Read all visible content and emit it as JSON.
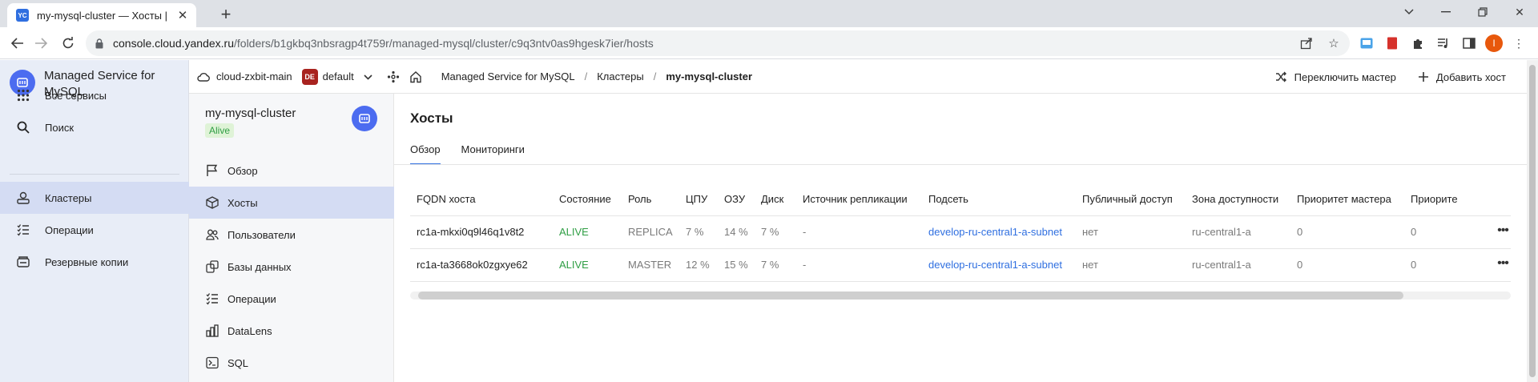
{
  "browser": {
    "tab_title": "my-mysql-cluster — Хосты | Кл",
    "tab_favicon_text": "YC",
    "url_host": "console.cloud.yandex.ru",
    "url_path": "/folders/b1gkbq3nbsragp4t759r/managed-mysql/cluster/c9q3ntv0as9hgesk7ier/hosts",
    "profile_initial": "I"
  },
  "service": {
    "name": "Managed Service for MySQL",
    "nav": [
      {
        "label": "Все сервисы",
        "icon": "grid-icon"
      },
      {
        "label": "Поиск",
        "icon": "search-icon"
      },
      {
        "label": "Кластеры",
        "icon": "clusters-icon",
        "active": true
      },
      {
        "label": "Операции",
        "icon": "operations-icon"
      },
      {
        "label": "Резервные копии",
        "icon": "backup-icon"
      }
    ]
  },
  "topbar": {
    "cloud": "cloud-zxbit-main",
    "folder_badge": "DE",
    "folder": "default",
    "breadcrumbs": [
      "Managed Service for MySQL",
      "Кластеры",
      "my-mysql-cluster"
    ],
    "actions": {
      "switch_master": "Переключить мастер",
      "add_host": "Добавить хост"
    }
  },
  "cluster": {
    "name": "my-mysql-cluster",
    "status": "Alive",
    "nav": [
      {
        "label": "Обзор",
        "icon": "flag-icon"
      },
      {
        "label": "Хосты",
        "icon": "cube-icon",
        "active": true
      },
      {
        "label": "Пользователи",
        "icon": "users-icon"
      },
      {
        "label": "Базы данных",
        "icon": "databases-icon"
      },
      {
        "label": "Операции",
        "icon": "operations-icon"
      },
      {
        "label": "DataLens",
        "icon": "chart-icon"
      },
      {
        "label": "SQL",
        "icon": "terminal-icon"
      }
    ]
  },
  "page": {
    "title": "Хосты",
    "tabs": [
      "Обзор",
      "Мониторинги"
    ],
    "columns": [
      "FQDN хоста",
      "Состояние",
      "Роль",
      "ЦПУ",
      "ОЗУ",
      "Диск",
      "Источник репликации",
      "Подсеть",
      "Публичный доступ",
      "Зона доступности",
      "Приоритет мастера",
      "Приорите"
    ],
    "rows": [
      {
        "fqdn": "rc1a-mkxi0q9l46q1v8t2",
        "state": "ALIVE",
        "role": "REPLICA",
        "cpu": "7 %",
        "ram": "14 %",
        "disk": "7 %",
        "source": "-",
        "subnet": "develop-ru-central1-a-subnet",
        "public": "нет",
        "zone": "ru-central1-a",
        "master_priority": "0",
        "priority": "0"
      },
      {
        "fqdn": "rc1a-ta3668ok0zgxye62",
        "state": "ALIVE",
        "role": "MASTER",
        "cpu": "12 %",
        "ram": "15 %",
        "disk": "7 %",
        "source": "-",
        "subnet": "develop-ru-central1-a-subnet",
        "public": "нет",
        "zone": "ru-central1-a",
        "master_priority": "0",
        "priority": "0"
      }
    ]
  },
  "colors": {
    "accent": "#2f6fe0",
    "alive": "#2f9e44",
    "brand": "#4c6cf0"
  }
}
